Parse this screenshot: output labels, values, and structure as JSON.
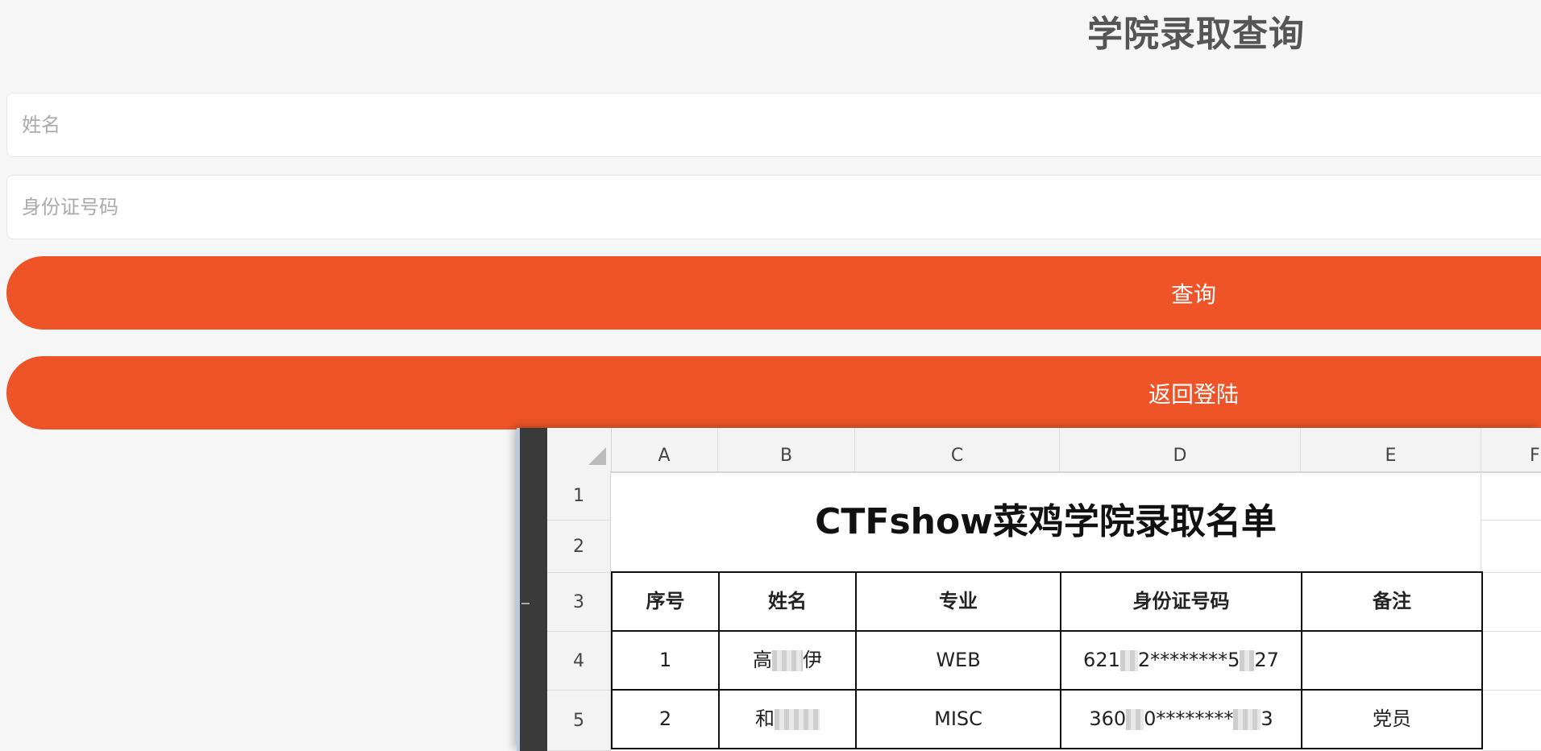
{
  "page": {
    "title": "学院录取查询"
  },
  "form": {
    "name_placeholder": "姓名",
    "id_placeholder": "身份证号码",
    "query_label": "查询",
    "back_label": "返回登陆"
  },
  "sheet": {
    "columns": [
      "A",
      "B",
      "C",
      "D",
      "E",
      "F"
    ],
    "rows": [
      "1",
      "2",
      "3",
      "4",
      "5"
    ],
    "title": "CTFshow菜鸡学院录取名单",
    "headers": [
      "序号",
      "姓名",
      "专业",
      "身份证号码",
      "备注"
    ],
    "records": [
      {
        "index": "1",
        "name_pre": "高",
        "name_post": "伊",
        "major": "WEB",
        "id_pre": "621",
        "id_mid": "2********5",
        "id_post": "27",
        "note": ""
      },
      {
        "index": "2",
        "name_pre": "和",
        "name_post": "",
        "major": "MISC",
        "id_pre": "360",
        "id_mid": "0********",
        "id_post": "3",
        "note": "党员"
      }
    ]
  }
}
